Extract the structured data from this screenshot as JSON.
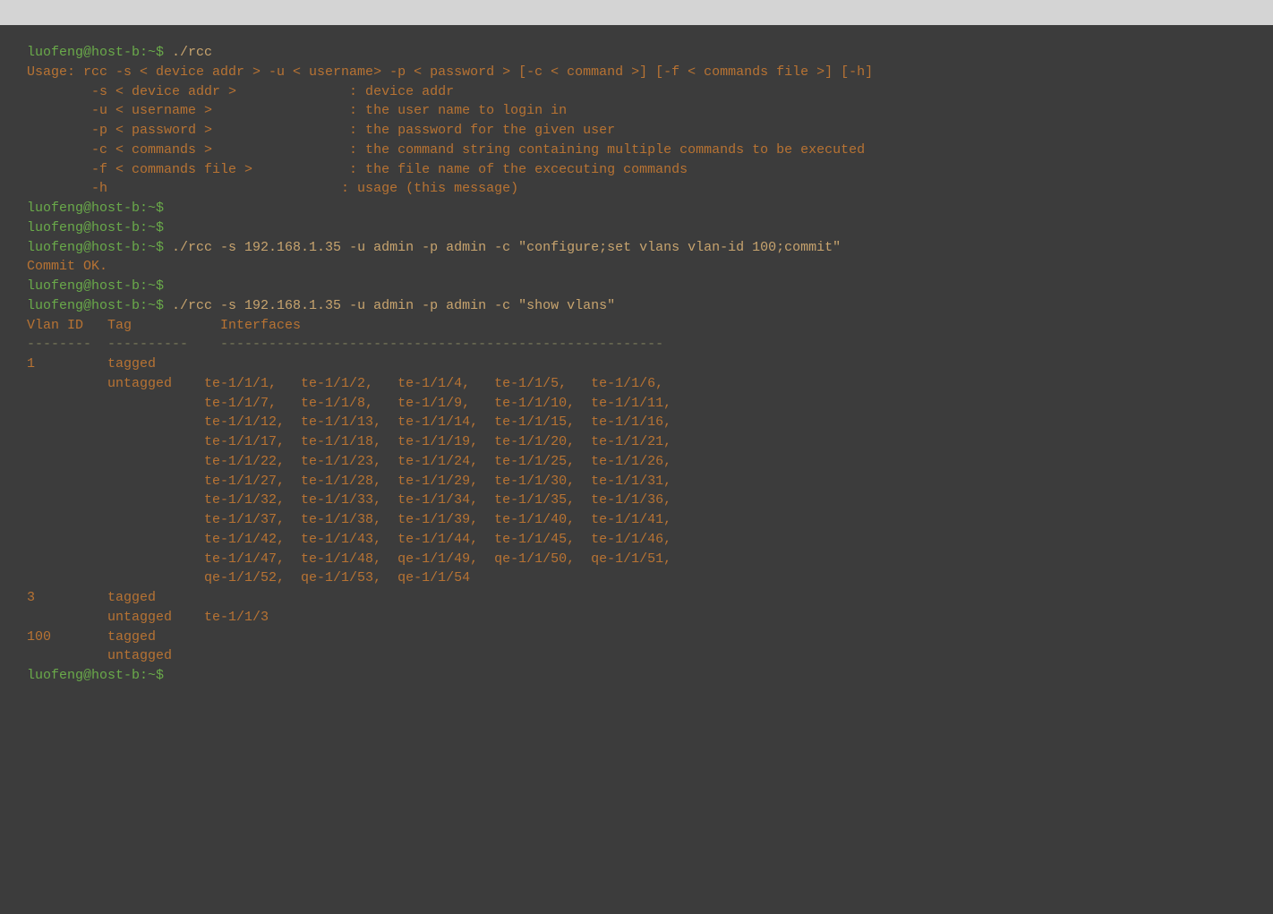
{
  "terminal": {
    "top_bar_color": "#d4d4d4",
    "bg_color": "#3c3c3c",
    "text_color": "#b87333",
    "lines": [
      {
        "type": "command",
        "prompt": "luofeng@host-b:~$ ",
        "cmd": "./rcc"
      },
      {
        "type": "normal",
        "text": "Usage: rcc -s < device addr > -u < username> -p < password > [-c < command >] [-f < commands file >] [-h]"
      },
      {
        "type": "normal",
        "text": ""
      },
      {
        "type": "normal",
        "text": "        -s < device addr >              : device addr"
      },
      {
        "type": "normal",
        "text": "        -u < username >                 : the user name to login in"
      },
      {
        "type": "normal",
        "text": "        -p < password >                 : the password for the given user"
      },
      {
        "type": "normal",
        "text": "        -c < commands >                 : the command string containing multiple commands to be executed"
      },
      {
        "type": "normal",
        "text": "        -f < commands file >            : the file name of the excecuting commands"
      },
      {
        "type": "normal",
        "text": "        -h                             : usage (this message)"
      },
      {
        "type": "normal",
        "text": ""
      },
      {
        "type": "prompt_only",
        "prompt": "luofeng@host-b:~$ "
      },
      {
        "type": "prompt_only",
        "prompt": "luofeng@host-b:~$ "
      },
      {
        "type": "command",
        "prompt": "luofeng@host-b:~$ ",
        "cmd": "./rcc -s 192.168.1.35 -u admin -p admin -c \"configure;set vlans vlan-id 100;commit\""
      },
      {
        "type": "normal",
        "text": "Commit OK."
      },
      {
        "type": "prompt_only",
        "prompt": "luofeng@host-b:~$ "
      },
      {
        "type": "command",
        "prompt": "luofeng@host-b:~$ ",
        "cmd": "./rcc -s 192.168.1.35 -u admin -p admin -c \"show vlans\""
      },
      {
        "type": "normal",
        "text": "Vlan ID   Tag           Interfaces"
      },
      {
        "type": "separator",
        "text": "--------  ----------    -------------------------------------------------------"
      },
      {
        "type": "normal",
        "text": "1         tagged"
      },
      {
        "type": "normal",
        "text": "          untagged    te-1/1/1,   te-1/1/2,   te-1/1/4,   te-1/1/5,   te-1/1/6,"
      },
      {
        "type": "normal",
        "text": "                      te-1/1/7,   te-1/1/8,   te-1/1/9,   te-1/1/10,  te-1/1/11,"
      },
      {
        "type": "normal",
        "text": "                      te-1/1/12,  te-1/1/13,  te-1/1/14,  te-1/1/15,  te-1/1/16,"
      },
      {
        "type": "normal",
        "text": "                      te-1/1/17,  te-1/1/18,  te-1/1/19,  te-1/1/20,  te-1/1/21,"
      },
      {
        "type": "normal",
        "text": "                      te-1/1/22,  te-1/1/23,  te-1/1/24,  te-1/1/25,  te-1/1/26,"
      },
      {
        "type": "normal",
        "text": "                      te-1/1/27,  te-1/1/28,  te-1/1/29,  te-1/1/30,  te-1/1/31,"
      },
      {
        "type": "normal",
        "text": "                      te-1/1/32,  te-1/1/33,  te-1/1/34,  te-1/1/35,  te-1/1/36,"
      },
      {
        "type": "normal",
        "text": "                      te-1/1/37,  te-1/1/38,  te-1/1/39,  te-1/1/40,  te-1/1/41,"
      },
      {
        "type": "normal",
        "text": "                      te-1/1/42,  te-1/1/43,  te-1/1/44,  te-1/1/45,  te-1/1/46,"
      },
      {
        "type": "normal",
        "text": "                      te-1/1/47,  te-1/1/48,  qe-1/1/49,  qe-1/1/50,  qe-1/1/51,"
      },
      {
        "type": "normal",
        "text": "                      qe-1/1/52,  qe-1/1/53,  qe-1/1/54"
      },
      {
        "type": "normal",
        "text": "3         tagged"
      },
      {
        "type": "normal",
        "text": "          untagged    te-1/1/3"
      },
      {
        "type": "normal",
        "text": "100       tagged"
      },
      {
        "type": "normal",
        "text": "          untagged"
      },
      {
        "type": "prompt_only",
        "prompt": "luofeng@host-b:~$ "
      }
    ]
  }
}
